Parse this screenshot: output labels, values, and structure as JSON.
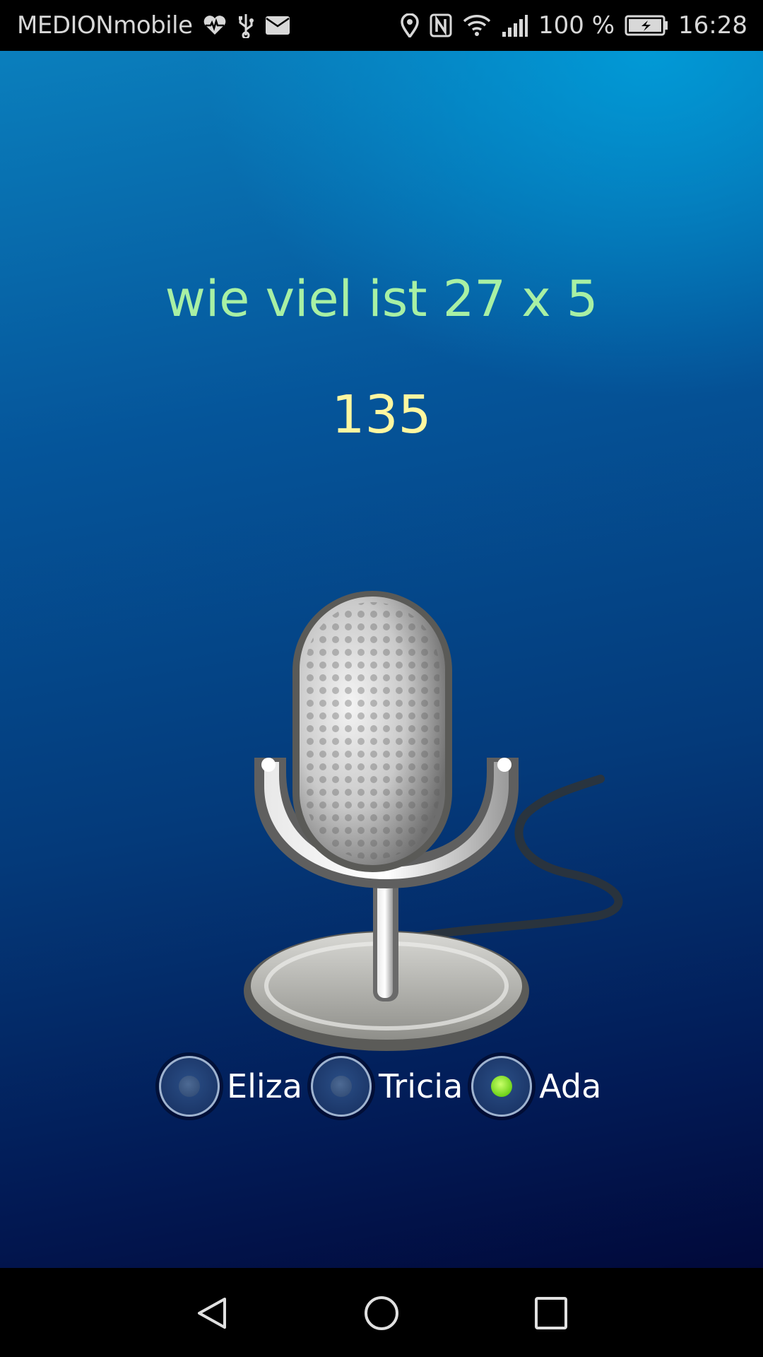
{
  "status_bar": {
    "carrier": "MEDIONmobile",
    "battery": "100 %",
    "time": "16:28",
    "left_icons": [
      "heart-rate-icon",
      "usb-icon",
      "mail-icon"
    ],
    "right_icons": [
      "location-icon",
      "nfc-icon",
      "wifi-icon",
      "signal-icon",
      "battery-charging-icon"
    ]
  },
  "main": {
    "question": "wie viel ist 27 x 5",
    "answer": "135",
    "mic_icon": "microphone-icon"
  },
  "voices": {
    "options": [
      {
        "label": "Eliza",
        "checked": false
      },
      {
        "label": "Tricia",
        "checked": false
      },
      {
        "label": "Ada",
        "checked": true
      }
    ]
  },
  "nav_bar": {
    "buttons": [
      "back-icon",
      "home-icon",
      "recents-icon"
    ]
  },
  "colors": {
    "question": "#a8f0a4",
    "answer": "#fff7a0",
    "radio_checked": "#6ed21a"
  }
}
